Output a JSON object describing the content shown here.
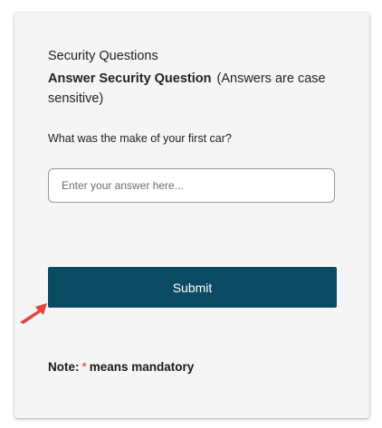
{
  "security": {
    "section_title": "Security Questions",
    "heading": "Answer Security Question",
    "heading_note": "(Answers are case sensitive)",
    "question": "What was the make of your first car?",
    "answer_placeholder": "Enter your answer here...",
    "answer_value": "",
    "submit_label": "Submit",
    "note_label": "Note:",
    "note_asterisk": "*",
    "note_text": "means mandatory"
  },
  "colors": {
    "card_background": "#f5f5f5",
    "button_background": "#0b4a63",
    "asterisk": "#d9342b",
    "arrow": "#e8453c"
  },
  "icons": {
    "pointer_arrow": "arrow-pointer-icon"
  }
}
